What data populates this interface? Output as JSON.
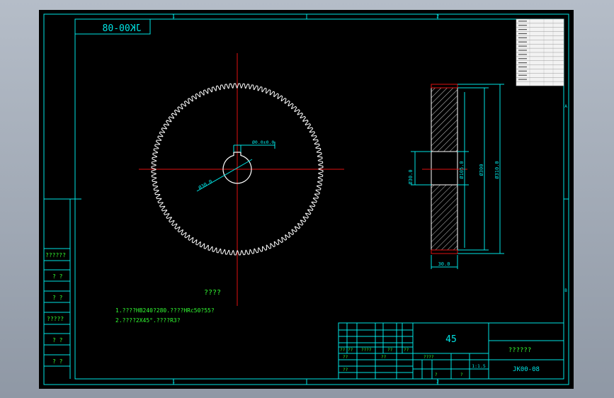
{
  "colors": {
    "background": "#000000",
    "frame": "#00e5e5",
    "centerline": "#e01010",
    "gear_outline": "#ffffff",
    "dimension": "#00e5e5",
    "text": "#33ff33"
  },
  "drawing": {
    "mirrored_code": "JK00-08",
    "zone_marks": {
      "top": [
        "1",
        "2"
      ],
      "bottom": [
        "1",
        "2"
      ],
      "right": [
        "A",
        "B"
      ]
    },
    "left_column_labels": [
      "??????",
      "? ?",
      "? ?",
      "?????",
      "? ?",
      "? ?"
    ],
    "front_view": {
      "bore_dimension": "Ø30.0",
      "keyway_dimension": "Ø0.0±0.0"
    },
    "section_view": {
      "bore_dim": "Ø30.0",
      "hub_dim": "Ø105.0",
      "root_dim": "Ø300",
      "tip_dim": "Ø310.0",
      "width_dim": "30.0"
    },
    "tech_title": "????",
    "notes": [
      "1.????HB240?280.????HRc50?55?",
      "2.????2X45°.????R3?"
    ],
    "title_block": {
      "material": "45",
      "name": "??????",
      "code": "JK00-08",
      "scale": "1:1.5",
      "small_labels": [
        "??",
        "??",
        "????",
        "??",
        "??",
        "??",
        "??",
        "??",
        "????",
        "?",
        "?"
      ]
    },
    "params_table_rows": 16
  }
}
